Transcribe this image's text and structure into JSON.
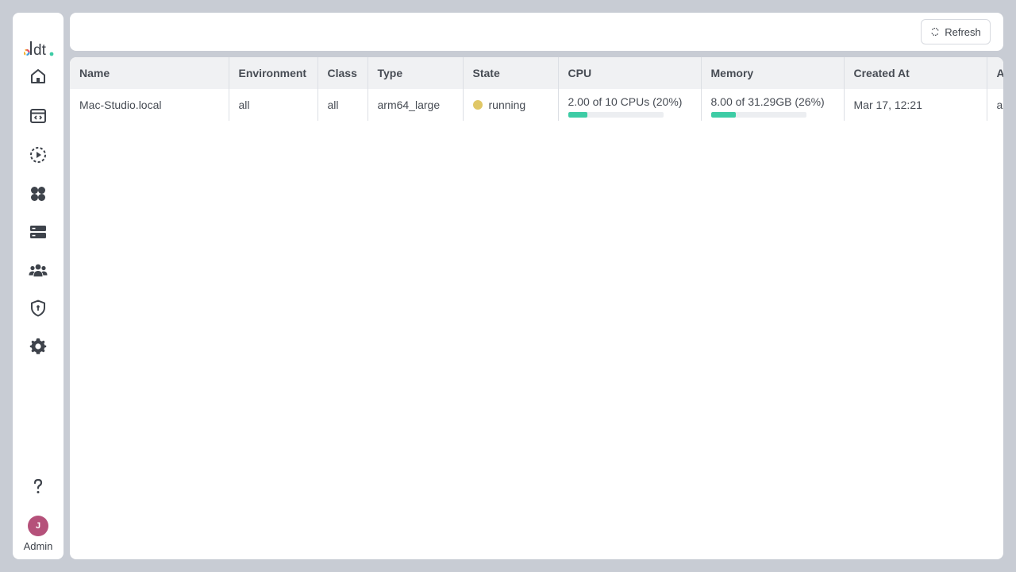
{
  "sidebar": {
    "logo_text": "dt",
    "nav": [
      {
        "name": "home-icon"
      },
      {
        "name": "code-window-icon"
      },
      {
        "name": "runs-play-icon"
      },
      {
        "name": "apps-grid-icon"
      },
      {
        "name": "servers-icon"
      },
      {
        "name": "users-icon"
      },
      {
        "name": "shield-lock-icon"
      },
      {
        "name": "gear-icon"
      }
    ],
    "help_icon": "question-icon",
    "avatar_initial": "J",
    "user_label": "Admin"
  },
  "toolbar": {
    "refresh_label": "Refresh",
    "refresh_icon": "refresh-icon"
  },
  "table": {
    "columns": [
      "Name",
      "Environment",
      "Class",
      "Type",
      "State",
      "CPU",
      "Memory",
      "Created At",
      "A"
    ],
    "rows": [
      {
        "name": "Mac-Studio.local",
        "environment": "all",
        "class": "all",
        "type": "arm64_large",
        "state": "running",
        "cpu": {
          "text": "2.00 of 10 CPUs (20%)",
          "fraction": 0.2
        },
        "memory": {
          "text": "8.00 of 31.29GB (26%)",
          "fraction": 0.26
        },
        "created_at": "Mar 17, 12:21",
        "a": "all"
      }
    ]
  },
  "colors": {
    "state_running": "#e0c766",
    "usage_bar": "#3dcca5",
    "avatar": "#b5517a"
  }
}
